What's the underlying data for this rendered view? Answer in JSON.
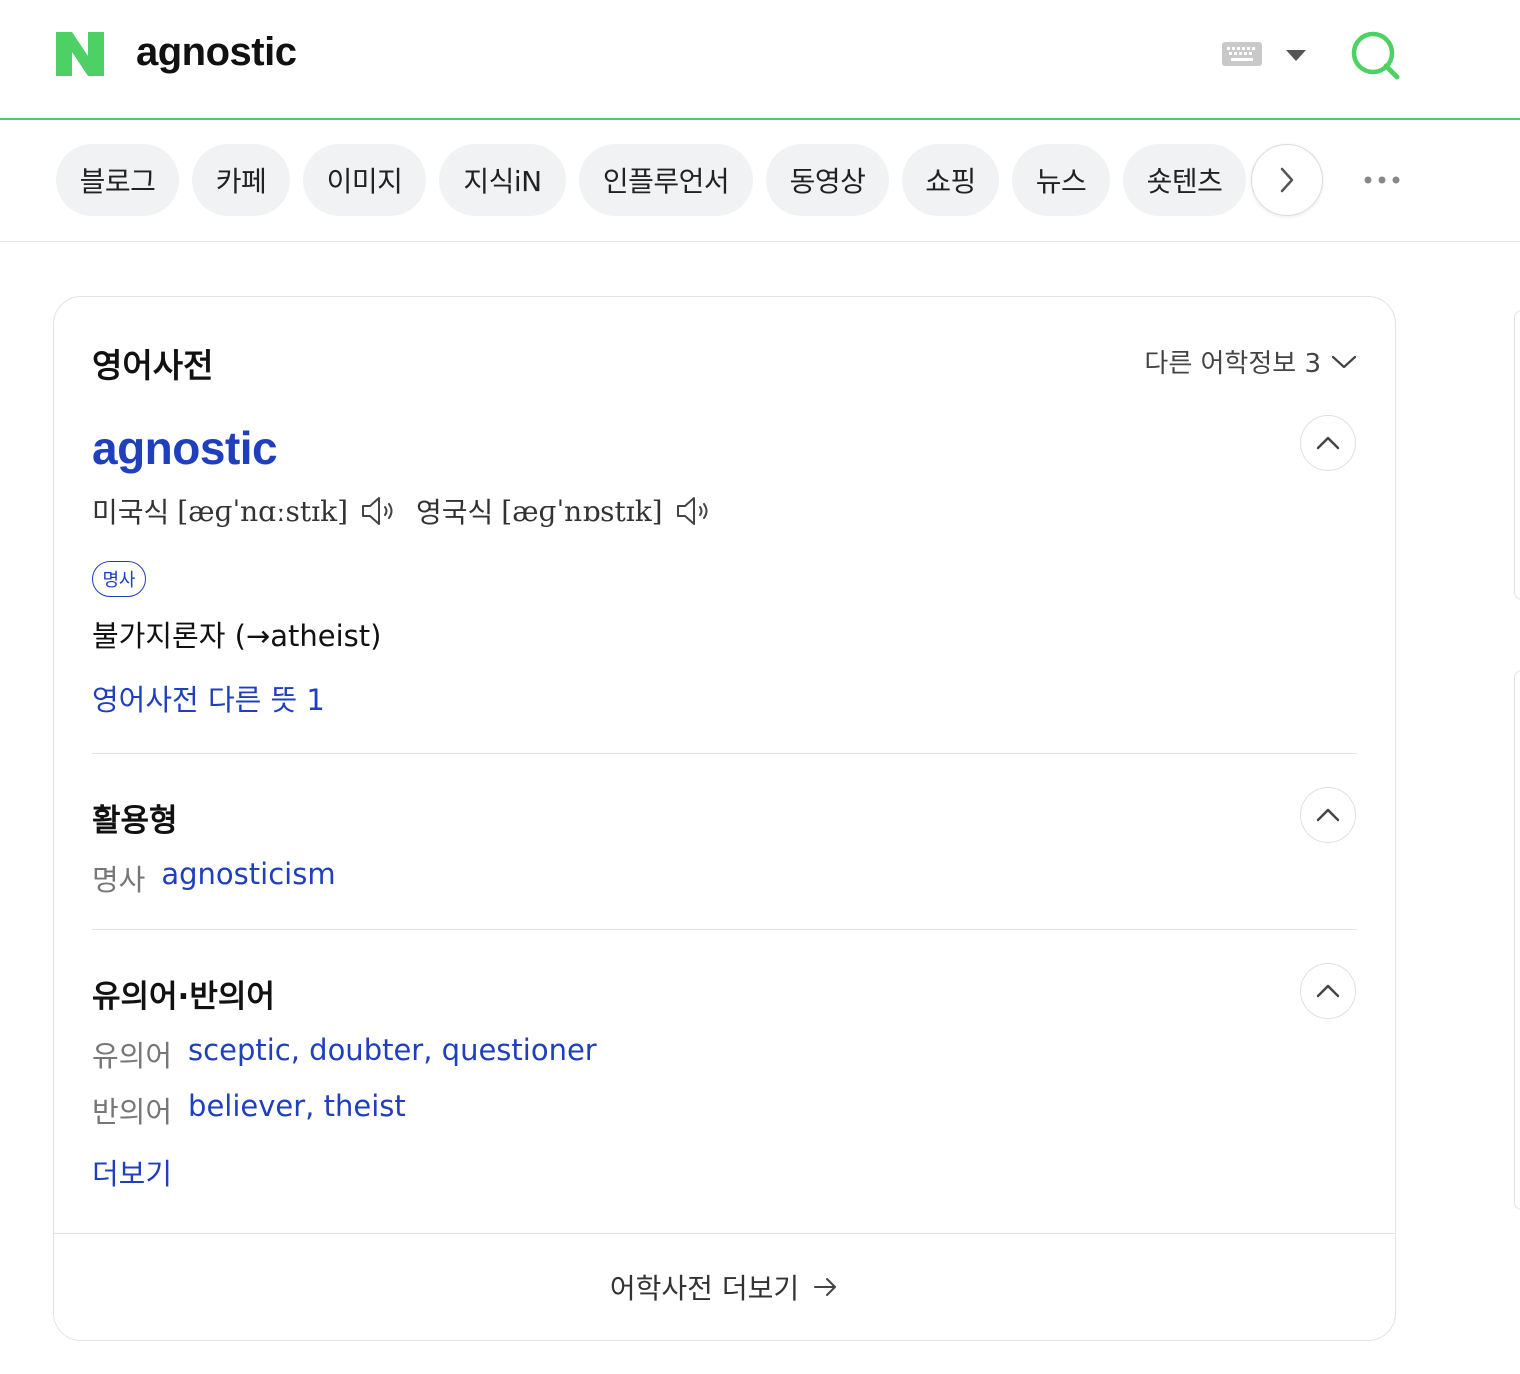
{
  "header": {
    "query": "agnostic",
    "icons": {
      "logo": "naver-n-logo",
      "keyboard": "keyboard-icon",
      "caret": "caret-down-icon",
      "search": "search-icon"
    },
    "brand_color": "#03c75a"
  },
  "tabs": [
    {
      "label": "블로그"
    },
    {
      "label": "카페"
    },
    {
      "label": "이미지"
    },
    {
      "label": "지식iN"
    },
    {
      "label": "인플루언서"
    },
    {
      "label": "동영상"
    },
    {
      "label": "쇼핑"
    },
    {
      "label": "뉴스"
    },
    {
      "label": "숏텐츠"
    }
  ],
  "dictionary": {
    "title": "영어사전",
    "other_info": "다른 어학정보 3",
    "headword": "agnostic",
    "pronunciations": [
      {
        "label": "미국식",
        "ipa": "[æɡˈnɑːstɪk]"
      },
      {
        "label": "영국식",
        "ipa": "[æɡˈnɒstɪk]"
      }
    ],
    "pos": "명사",
    "definition": "불가지론자 (→atheist)",
    "other_meaning_link": "영어사전 다른 뜻 1",
    "inflection": {
      "title": "활용형",
      "key": "명사",
      "value": "agnosticism"
    },
    "synonyms": {
      "title": "유의어·반의어",
      "syn_key": "유의어",
      "syn_value": "sceptic, doubter, questioner",
      "ant_key": "반의어",
      "ant_value": "believer, theist",
      "more": "더보기"
    },
    "footer": "어학사전 더보기",
    "accent_color": "#1f3fbf"
  }
}
